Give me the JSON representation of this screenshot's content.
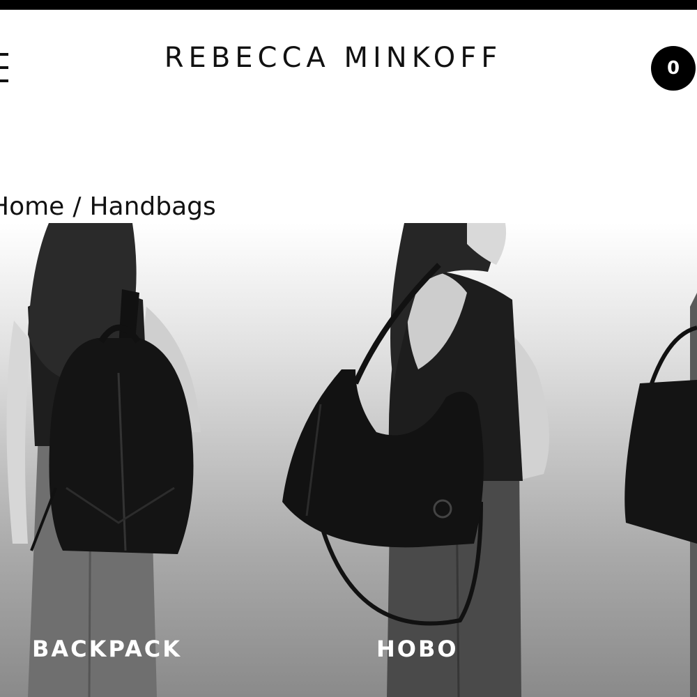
{
  "header": {
    "brand": "REBECCA MINKOFF",
    "cart_count": "0"
  },
  "breadcrumb": {
    "home": "Home",
    "separator": "/",
    "current": "Handbags"
  },
  "categories": [
    {
      "label": "BACKPACK"
    },
    {
      "label": "HOBO"
    },
    {
      "label": ""
    }
  ],
  "colors": {
    "top_bar": "#000000",
    "cart_badge": "#000000",
    "label_text": "#ffffff"
  }
}
